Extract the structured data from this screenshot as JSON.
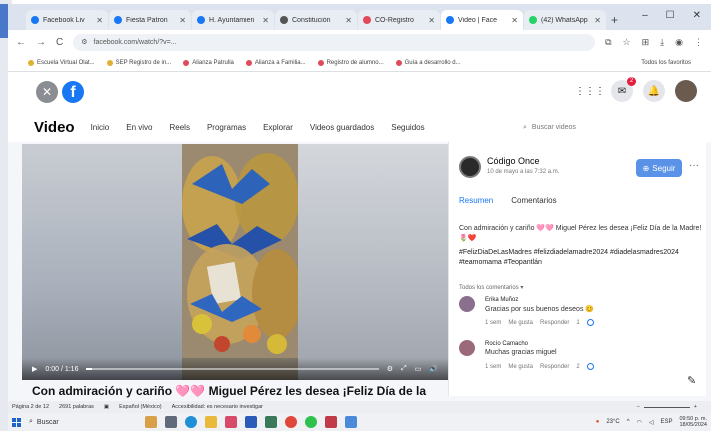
{
  "browser": {
    "tabs": [
      {
        "label": "Facebook Liv",
        "color": "#1877f2"
      },
      {
        "label": "Fiesta Patron",
        "color": "#1877f2"
      },
      {
        "label": "H. Ayuntamien",
        "color": "#1877f2"
      },
      {
        "label": "Constitución",
        "color": "#555555"
      },
      {
        "label": "CO-Registro",
        "color": "#e04a5a"
      },
      {
        "label": "Video | Face",
        "color": "#1877f2",
        "active": true
      },
      {
        "label": "(42) WhatsApp",
        "color": "#25d366"
      }
    ],
    "new_tab": "+",
    "window_controls": [
      "–",
      "☐",
      "✕"
    ],
    "url": "facebook.com/watch/?v=...",
    "nav": [
      "←",
      "→",
      "C"
    ],
    "bookmarks": [
      "Escuela Virtual Olat...",
      "SEP Registro de in...",
      "Alianza Patrulla",
      "Alianza a Familia...",
      "Registro de alumno...",
      "Guía a desarrollo d..."
    ],
    "all_favorites": "Todos los favoritos"
  },
  "facebook": {
    "close_glyph": "✕",
    "logo": "f",
    "notif_count": "2",
    "video_nav": {
      "title": "Video",
      "items": [
        "Inicio",
        "En vivo",
        "Reels",
        "Programas",
        "Explorar",
        "Videos guardados",
        "Seguidos"
      ]
    },
    "search_placeholder": "Buscar videos"
  },
  "video": {
    "time": "0:00 / 1:16",
    "progress": 0.02,
    "caption": "Con admiración y cariño 🩷🩷 Miguel Pérez les desea ¡Feliz Día de la"
  },
  "panel": {
    "page_name": "Código Once",
    "date": "10 de mayo a las 7:32 a.m.",
    "follow_label": "Seguir",
    "more": "···",
    "tab_summary": "Resumen",
    "tab_comments": "Comentarios",
    "description": "Con admiración y cariño 🩷🩷 Miguel Pérez les desea ¡Feliz Día de la Madre! 🌷❤️",
    "hashtags": "#FelizDiaDeLasMadres #felizdiadelamadre2024 #diadelasmadres2024 #teamomama #Teopantlán",
    "all_comments": "Todos los comentarios",
    "comments": [
      {
        "author": "Erika Muñoz",
        "text": "Gracias por sus buenos deseos 😊",
        "time": "1 sem",
        "like": "Me gusta",
        "reply": "Responder",
        "count": "1"
      },
      {
        "author": "Rocío Camacho",
        "text": "Muchas gracias miguel",
        "time": "1 sem",
        "like": "Me gusta",
        "reply": "Responder",
        "count": "2"
      }
    ]
  },
  "word_status": {
    "page": "Página 2 de 12",
    "words": "2691 palabras",
    "lang": "Español (México)",
    "accessibility": "Accesibilidad: es necesario investigar"
  },
  "taskbar": {
    "search": "Buscar",
    "temp": "23°C",
    "lang": "ESP",
    "time": "09:50 p. m.",
    "date": "18/05/2024"
  }
}
